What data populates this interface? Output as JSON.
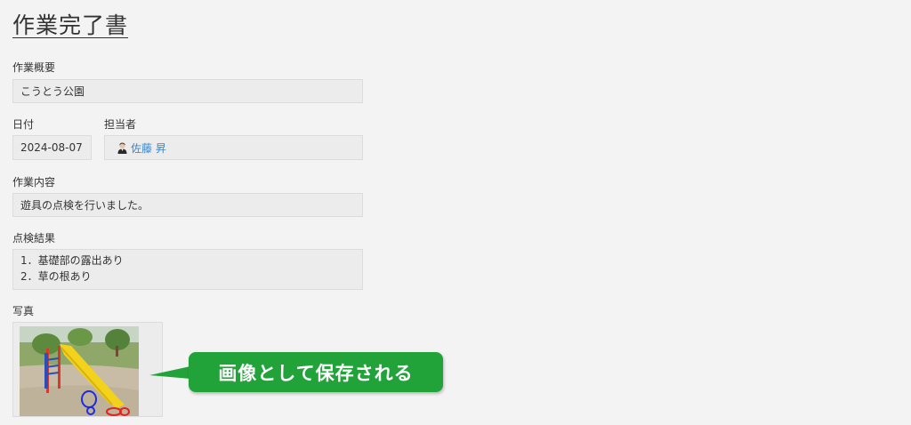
{
  "page": {
    "title": "作業完了書"
  },
  "overview": {
    "label": "作業概要",
    "value": "こうとう公園"
  },
  "date": {
    "label": "日付",
    "value": "2024-08-07"
  },
  "assignee": {
    "label": "担当者",
    "value": "佐藤 昇",
    "icon": "user-avatar-icon"
  },
  "content": {
    "label": "作業内容",
    "value": "遊具の点検を行いました。"
  },
  "results": {
    "label": "点検結果",
    "items": [
      "1．基礎部の露出あり",
      "2．草の根あり"
    ]
  },
  "photo": {
    "label": "写真"
  },
  "callout": {
    "text": "画像として保存される",
    "color": "#22a33a"
  },
  "colors": {
    "link": "#3b87c9",
    "background": "#f3f3f3",
    "field": "#ececec"
  }
}
